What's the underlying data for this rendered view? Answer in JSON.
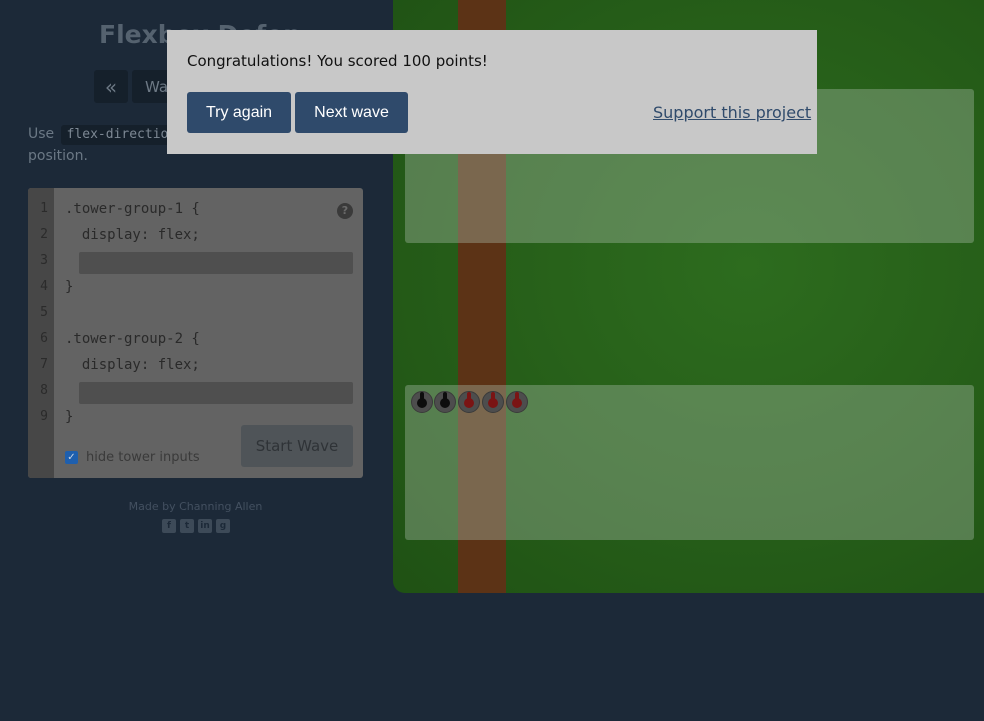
{
  "header": {
    "title": "Flexbox Defense"
  },
  "nav": {
    "prev_symbol": "«",
    "wave_label": "Wave"
  },
  "instructions": {
    "before": "Use",
    "property": "flex-direction",
    "after": "position."
  },
  "editor": {
    "line_numbers": [
      "1",
      "2",
      "3",
      "4",
      "5",
      "6",
      "7",
      "8",
      "9"
    ],
    "lines": [
      ".tower-group-1 {",
      "  display: flex;",
      "",
      "}",
      "",
      ".tower-group-2 {",
      "  display: flex;",
      "",
      "}"
    ],
    "help_symbol": "?",
    "hide_inputs_label": "hide tower inputs",
    "hide_inputs_checked": true,
    "start_label": "Start Wave"
  },
  "footer": {
    "credit": "Made by Channing Allen",
    "socials": [
      "facebook-icon",
      "twitter-icon",
      "linkedin-icon",
      "github-icon"
    ]
  },
  "board": {
    "towers": [
      {
        "color": "black"
      },
      {
        "color": "black"
      },
      {
        "color": "red"
      },
      {
        "color": "red"
      },
      {
        "color": "red"
      }
    ]
  },
  "modal": {
    "message": "Congratulations! You scored 100 points!",
    "try_again": "Try again",
    "next_wave": "Next wave",
    "support": "Support this project"
  },
  "colors": {
    "modal_button": "#2f4a6b",
    "board_green": "#2d6c1e",
    "path_brown": "#5c3316",
    "page_bg": "#1c2938"
  }
}
